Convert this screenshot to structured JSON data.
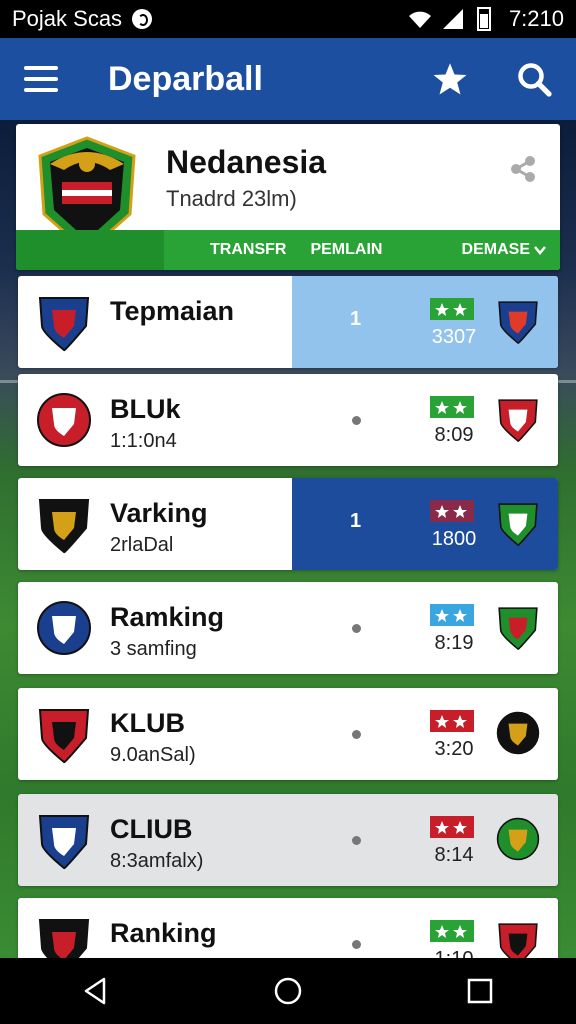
{
  "status_bar": {
    "carrier": "Pojak Scas",
    "time": "7:210"
  },
  "app_bar": {
    "title": "Deparball"
  },
  "header": {
    "team_name": "Nedanesia",
    "team_sub": "Tnadrd 23lm)",
    "tabs": [
      "TRANSFR",
      "PEMLAIN",
      "DEMASE"
    ]
  },
  "rows": [
    {
      "title": "Tepmaian",
      "sub": "",
      "round": "1",
      "time": "3307",
      "flag_color": "#2aa336",
      "panel": "light",
      "crest_colors": [
        "#1a3f8f",
        "#c81e2a"
      ],
      "opp_colors": [
        "#1a3f8f",
        "#e03a2b"
      ],
      "bg": "white"
    },
    {
      "title": "BLUk",
      "sub": "1:1:0n4",
      "round": "",
      "time": "8:09",
      "flag_color": "#2aa336",
      "panel": "none",
      "crest_colors": [
        "#c81e2a",
        "#ffffff"
      ],
      "opp_colors": [
        "#c81e2a",
        "#ffffff"
      ],
      "bg": "white"
    },
    {
      "title": "Varking",
      "sub": "2rlaDal",
      "round": "1",
      "time": "1800",
      "flag_color": "#8a2a4a",
      "panel": "dark",
      "crest_colors": [
        "#111111",
        "#d4a017"
      ],
      "opp_colors": [
        "#1f8f2c",
        "#ffffff"
      ],
      "bg": "white"
    },
    {
      "title": "Ramking",
      "sub": "3 samfing",
      "round": "",
      "time": "8:19",
      "flag_color": "#3aa6e0",
      "panel": "none",
      "crest_colors": [
        "#1a3f8f",
        "#ffffff"
      ],
      "opp_colors": [
        "#1f8f2c",
        "#c81e2a"
      ],
      "bg": "white"
    },
    {
      "title": "KLUB",
      "sub": "9.0anSal)",
      "round": "",
      "time": "3:20",
      "flag_color": "#c81e2a",
      "panel": "none",
      "crest_colors": [
        "#c81e2a",
        "#111111"
      ],
      "opp_colors": [
        "#111111",
        "#d4a017"
      ],
      "bg": "white"
    },
    {
      "title": "CLIUB",
      "sub": "8:3amfalx)",
      "round": "",
      "time": "8:14",
      "flag_color": "#c81e2a",
      "panel": "none",
      "crest_colors": [
        "#1a3f8f",
        "#ffffff"
      ],
      "opp_colors": [
        "#1f8f2c",
        "#d4a017"
      ],
      "bg": "grey"
    },
    {
      "title": "Ranking",
      "sub": "",
      "round": "",
      "time": "1:10",
      "flag_color": "#2aa336",
      "panel": "none",
      "crest_colors": [
        "#111111",
        "#c81e2a"
      ],
      "opp_colors": [
        "#c81e2a",
        "#111111"
      ],
      "bg": "white"
    }
  ]
}
